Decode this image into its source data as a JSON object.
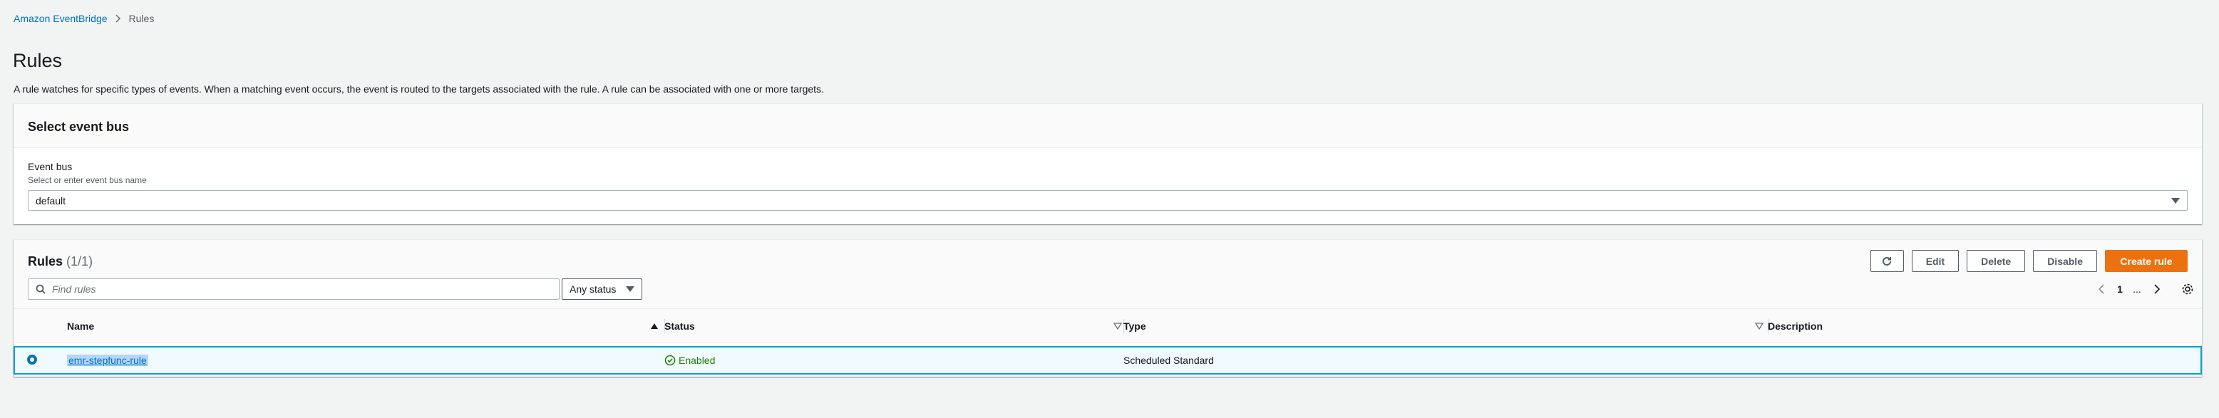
{
  "breadcrumb": {
    "root": "Amazon EventBridge",
    "current": "Rules"
  },
  "page": {
    "title": "Rules",
    "description": "A rule watches for specific types of events. When a matching event occurs, the event is routed to the targets associated with the rule. A rule can be associated with one or more targets."
  },
  "event_bus_panel": {
    "title": "Select event bus",
    "label": "Event bus",
    "hint": "Select or enter event bus name",
    "value": "default"
  },
  "rules_panel": {
    "title": "Rules",
    "count": "(1/1)",
    "buttons": {
      "edit": "Edit",
      "delete": "Delete",
      "disable": "Disable",
      "create": "Create rule"
    },
    "search_placeholder": "Find rules",
    "status_filter": "Any status",
    "pagination": {
      "current_page": "1",
      "ellipsis": "..."
    },
    "columns": {
      "name": "Name",
      "status": "Status",
      "type": "Type",
      "description": "Description"
    },
    "rows": [
      {
        "name": "emr-stepfunc-rule",
        "status": "Enabled",
        "type": "Scheduled Standard",
        "description": ""
      }
    ]
  },
  "colors": {
    "primary": "#ec7211",
    "link": "#0073bb",
    "success": "#1d8102",
    "selected_border": "#00a1c9"
  }
}
